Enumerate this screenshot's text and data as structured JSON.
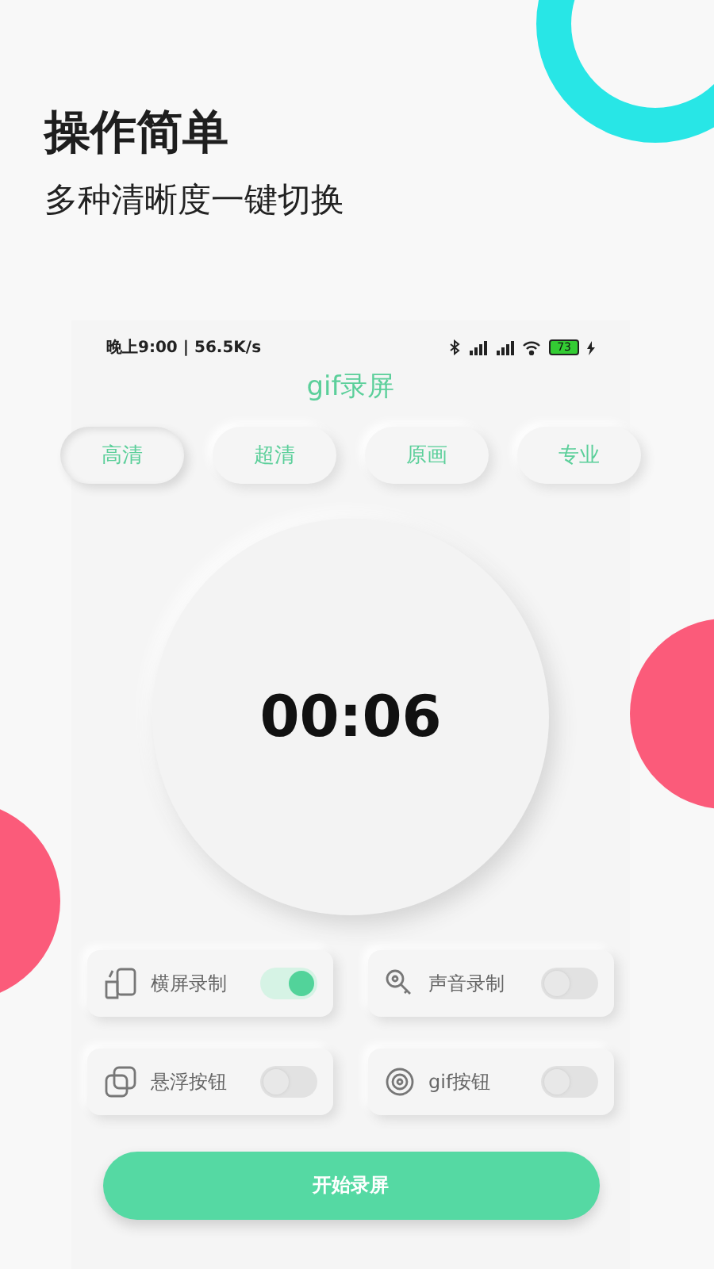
{
  "headline": "操作简单",
  "subline": "多种清晰度一键切换",
  "status_bar": {
    "time": "晚上9:00 | 56.5K/s",
    "battery": "73"
  },
  "app_title": "gif录屏",
  "tabs": [
    {
      "label": "高清",
      "selected": true
    },
    {
      "label": "超清",
      "selected": false
    },
    {
      "label": "原画",
      "selected": false
    },
    {
      "label": "专业",
      "selected": false
    }
  ],
  "timer": "00:06",
  "toggles": [
    {
      "label": "横屏录制",
      "on": true
    },
    {
      "label": "声音录制",
      "on": false
    },
    {
      "label": "悬浮按钮",
      "on": false
    },
    {
      "label": "gif按钮",
      "on": false
    }
  ],
  "start_button": "开始录屏"
}
